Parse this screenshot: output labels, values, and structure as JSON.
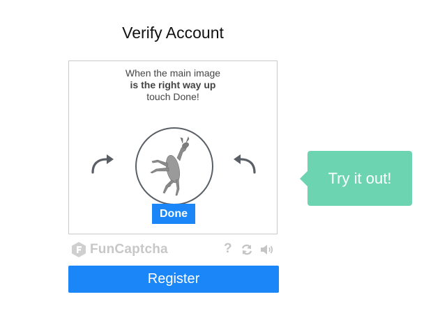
{
  "header": {
    "title": "Verify Account"
  },
  "challenge": {
    "line1": "When the main image",
    "line2": "is the right way up",
    "line3": "touch Done!",
    "done_label": "Done",
    "image_subject": "deer (upside down)"
  },
  "footer": {
    "brand": "FunCaptcha",
    "help_label": "?",
    "icons": [
      "funcaptcha-logo-icon",
      "help-icon",
      "reload-icon",
      "audio-icon"
    ]
  },
  "register": {
    "label": "Register"
  },
  "tooltip": {
    "text": "Try it out!"
  },
  "colors": {
    "accent": "#1b86f8",
    "tooltip": "#6dd4b1",
    "border": "#c9c9c9",
    "circle_border": "#5a5f66",
    "muted_icon": "#c7c7c7"
  }
}
